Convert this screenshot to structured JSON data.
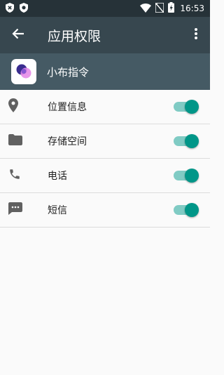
{
  "status_bar": {
    "time": "16:53",
    "left_icons": [
      "shield-x-icon",
      "shield-badge-icon"
    ],
    "right_icons": [
      "wifi-icon",
      "no-sim-icon",
      "battery-charging-icon"
    ]
  },
  "app_bar": {
    "title": "应用权限",
    "back_icon": "arrow-back-icon",
    "more_icon": "more-vert-icon",
    "color": "#37474f"
  },
  "app_header": {
    "name": "小布指令",
    "color": "#455a64"
  },
  "permissions": [
    {
      "label": "位置信息",
      "icon": "location-icon",
      "enabled": true
    },
    {
      "label": "存储空间",
      "icon": "folder-icon",
      "enabled": true
    },
    {
      "label": "电话",
      "icon": "phone-icon",
      "enabled": true
    },
    {
      "label": "短信",
      "icon": "sms-icon",
      "enabled": true
    }
  ],
  "colors": {
    "switch_on_thumb": "#009688",
    "switch_on_track": "#80cbc4",
    "icon_gray": "#616161"
  }
}
